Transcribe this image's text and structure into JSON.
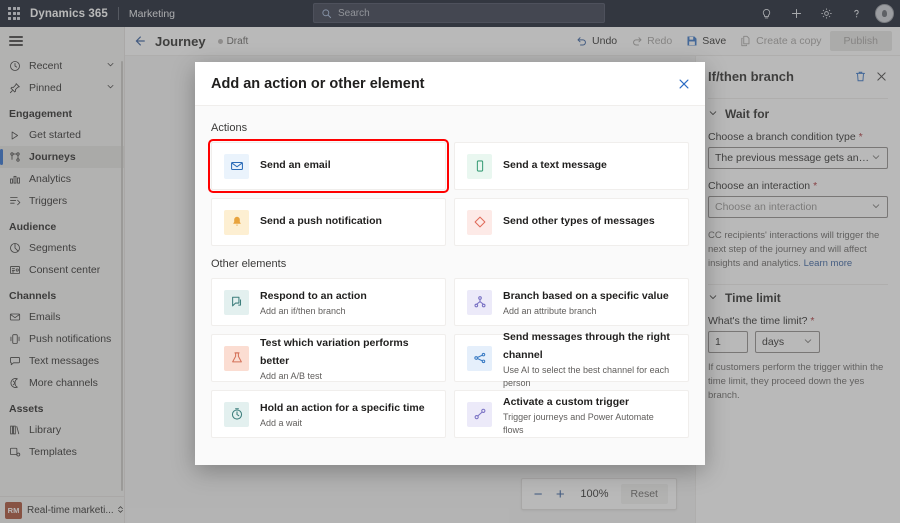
{
  "suite": {
    "waffle_icon": "app-launcher-icon",
    "brand": "Dynamics 365",
    "app_name": "Marketing",
    "search": {
      "placeholder": "Search",
      "value": "",
      "icon": "search-icon"
    },
    "actions": [
      {
        "name": "lightbulb-icon",
        "glyph": "idea"
      },
      {
        "name": "plus-icon",
        "glyph": "add"
      },
      {
        "name": "gear-icon",
        "glyph": "settings"
      },
      {
        "name": "question-icon",
        "glyph": "help"
      }
    ],
    "avatar": "user-avatar"
  },
  "sidebar": {
    "hamburger": "menu-icon",
    "quick": [
      {
        "label": "Recent",
        "icon": "clock-icon",
        "expandable": true
      },
      {
        "label": "Pinned",
        "icon": "pin-icon",
        "expandable": true
      }
    ],
    "groups": [
      {
        "title": "Engagement",
        "items": [
          {
            "label": "Get started",
            "icon": "play-icon",
            "selected": false
          },
          {
            "label": "Journeys",
            "icon": "journeys-icon",
            "selected": true
          },
          {
            "label": "Analytics",
            "icon": "analytics-icon",
            "selected": false
          },
          {
            "label": "Triggers",
            "icon": "triggers-icon",
            "selected": false
          }
        ]
      },
      {
        "title": "Audience",
        "items": [
          {
            "label": "Segments",
            "icon": "segments-icon",
            "selected": false
          },
          {
            "label": "Consent center",
            "icon": "consent-icon",
            "selected": false
          }
        ]
      },
      {
        "title": "Channels",
        "items": [
          {
            "label": "Emails",
            "icon": "email-icon",
            "selected": false
          },
          {
            "label": "Push notifications",
            "icon": "push-icon",
            "selected": false
          },
          {
            "label": "Text messages",
            "icon": "sms-icon",
            "selected": false
          },
          {
            "label": "More channels",
            "icon": "more-channels-icon",
            "selected": false
          }
        ]
      },
      {
        "title": "Assets",
        "items": [
          {
            "label": "Library",
            "icon": "library-icon",
            "selected": false
          },
          {
            "label": "Templates",
            "icon": "templates-icon",
            "selected": false
          }
        ]
      }
    ],
    "area_switcher": {
      "badge": "RM",
      "label": "Real-time marketi...",
      "badge_color": "#a4452b",
      "icon": "chevron-updown-icon"
    }
  },
  "commandbar": {
    "back_icon": "back-arrow-icon",
    "title": "Journey",
    "status": "Draft",
    "buttons": [
      {
        "label": "Undo",
        "icon": "undo-icon",
        "disabled": false
      },
      {
        "label": "Redo",
        "icon": "redo-icon",
        "disabled": true
      },
      {
        "label": "Save",
        "icon": "save-icon",
        "disabled": false
      },
      {
        "label": "Create a copy",
        "icon": "copy-icon",
        "disabled": true
      }
    ],
    "publish_label": "Publish"
  },
  "canvas": {
    "zoom": {
      "minus": "−",
      "plus": "+",
      "value": "100%",
      "reset_label": "Reset"
    }
  },
  "right_panel": {
    "title": "If/then branch",
    "delete_icon": "trash-icon",
    "close_icon": "close-icon",
    "sections": [
      {
        "name": "wait-for",
        "title": "Wait for",
        "chevron": "chevron-down-icon",
        "fields": [
          {
            "label": "Choose a branch condition type",
            "required": true,
            "value": "The previous message gets an interacti...",
            "is_placeholder": false
          },
          {
            "label": "Choose an interaction",
            "required": true,
            "value": "Choose an interaction",
            "is_placeholder": true
          }
        ],
        "help": "CC recipients' interactions will trigger the next step of the journey and will affect insights and analytics.",
        "help_link": "Learn more"
      },
      {
        "name": "time-limit",
        "title": "Time limit",
        "chevron": "chevron-down-icon",
        "fields": [
          {
            "label": "What's the time limit?",
            "required": true,
            "amount": "1",
            "unit": "days"
          }
        ],
        "help": "If customers perform the trigger within the time limit, they proceed down the yes branch."
      }
    ]
  },
  "modal": {
    "title": "Add an action or other element",
    "close_icon": "close-icon",
    "sections": [
      {
        "title": "Actions",
        "cards": [
          {
            "title": "Send an email",
            "subtitle": "",
            "icon": "email-icon",
            "tile_bg": "#eaf3fc",
            "icon_color": "#2b6cb8",
            "highlighted": true
          },
          {
            "title": "Send a text message",
            "subtitle": "",
            "icon": "sms-icon",
            "tile_bg": "#e9f7f0",
            "icon_color": "#3a9e78",
            "highlighted": false
          },
          {
            "title": "Send a push notification",
            "subtitle": "",
            "icon": "push-bell-icon",
            "tile_bg": "#fdefd2",
            "icon_color": "#e8a33d",
            "highlighted": false
          },
          {
            "title": "Send other types of messages",
            "subtitle": "",
            "icon": "other-messages-icon",
            "tile_bg": "#fdeae7",
            "icon_color": "#e06c5a",
            "highlighted": false
          }
        ]
      },
      {
        "title": "Other elements",
        "cards": [
          {
            "title": "Respond to an action",
            "subtitle": "Add an if/then branch",
            "icon": "respond-icon",
            "tile_bg": "#e3f0ef",
            "icon_color": "#3d7e7c",
            "highlighted": false
          },
          {
            "title": "Branch based on a specific value",
            "subtitle": "Add an attribute branch",
            "icon": "branch-icon",
            "tile_bg": "#eceaf9",
            "icon_color": "#7a72c4",
            "highlighted": false
          },
          {
            "title": "Test which variation performs better",
            "subtitle": "Add an A/B test",
            "icon": "ab-test-icon",
            "tile_bg": "#fbddd2",
            "icon_color": "#d4725a",
            "highlighted": false
          },
          {
            "title": "Send messages through the right channel",
            "subtitle": "Use AI to select the best channel for each person",
            "icon": "channel-ai-icon",
            "tile_bg": "#e5effb",
            "icon_color": "#3b7cc4",
            "highlighted": false
          },
          {
            "title": "Hold an action for a specific time",
            "subtitle": "Add a wait",
            "icon": "timer-icon",
            "tile_bg": "#e3f0ef",
            "icon_color": "#3d7e7c",
            "highlighted": false
          },
          {
            "title": "Activate a custom trigger",
            "subtitle": "Trigger journeys and Power Automate flows",
            "icon": "custom-trigger-icon",
            "tile_bg": "#eceaf9",
            "icon_color": "#7a72c4",
            "highlighted": false
          }
        ]
      }
    ]
  },
  "colors": {
    "suitebar_bg": "#0b1324",
    "accent_blue": "#2b579a",
    "highlight_red": "#ff0000",
    "selected_nav": "#e4e3e1"
  }
}
